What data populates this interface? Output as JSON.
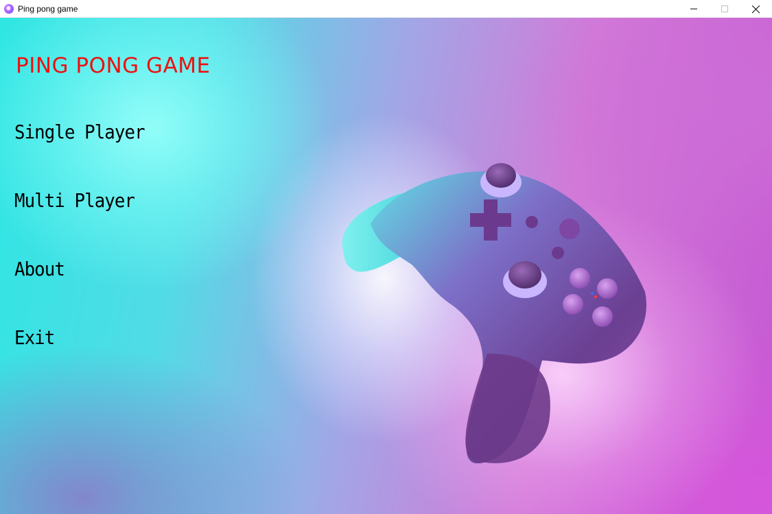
{
  "window": {
    "title": "Ping pong game",
    "icons": {
      "app": "app-logo-icon",
      "minimize": "minimize-icon",
      "maximize": "maximize-icon",
      "close": "close-icon"
    }
  },
  "game": {
    "title": "PING PONG GAME",
    "title_color": "#ee1111",
    "menu": [
      {
        "label": "Single Player"
      },
      {
        "label": "Multi Player"
      },
      {
        "label": "About"
      },
      {
        "label": "Exit"
      }
    ],
    "background_image": "game-controller"
  },
  "colors": {
    "cyan": "#2ee6e3",
    "magenta": "#c558d3",
    "controller": "#8a4aa3"
  }
}
